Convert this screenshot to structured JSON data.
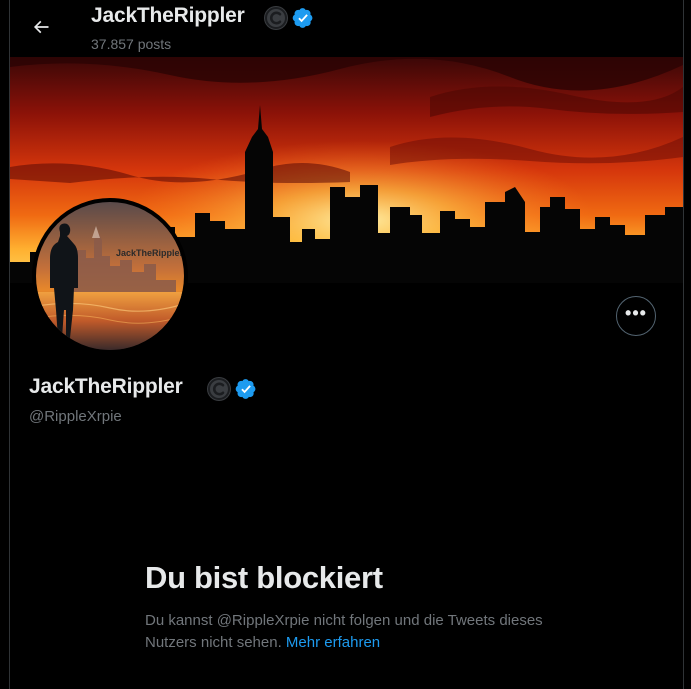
{
  "header": {
    "back_icon": "arrow-left-icon",
    "name": "JackTheRippler",
    "posts": "37.857 posts"
  },
  "avatar": {
    "text": "JackTheRippler"
  },
  "profile": {
    "name": "JackTheRippler",
    "handle": "@RippleXrpie",
    "more_icon": "ellipsis-icon",
    "more_label": "•••"
  },
  "blocked": {
    "title": "Du bist blockiert",
    "text": "Du kannst @RippleXrpie nicht folgen und die Tweets dieses Nutzers nicht sehen.",
    "link": "Mehr erfahren"
  },
  "colors": {
    "background": "#000000",
    "text_primary": "#e7e9ea",
    "text_secondary": "#71767b",
    "accent": "#1d9bf0",
    "border": "#2f3336"
  }
}
